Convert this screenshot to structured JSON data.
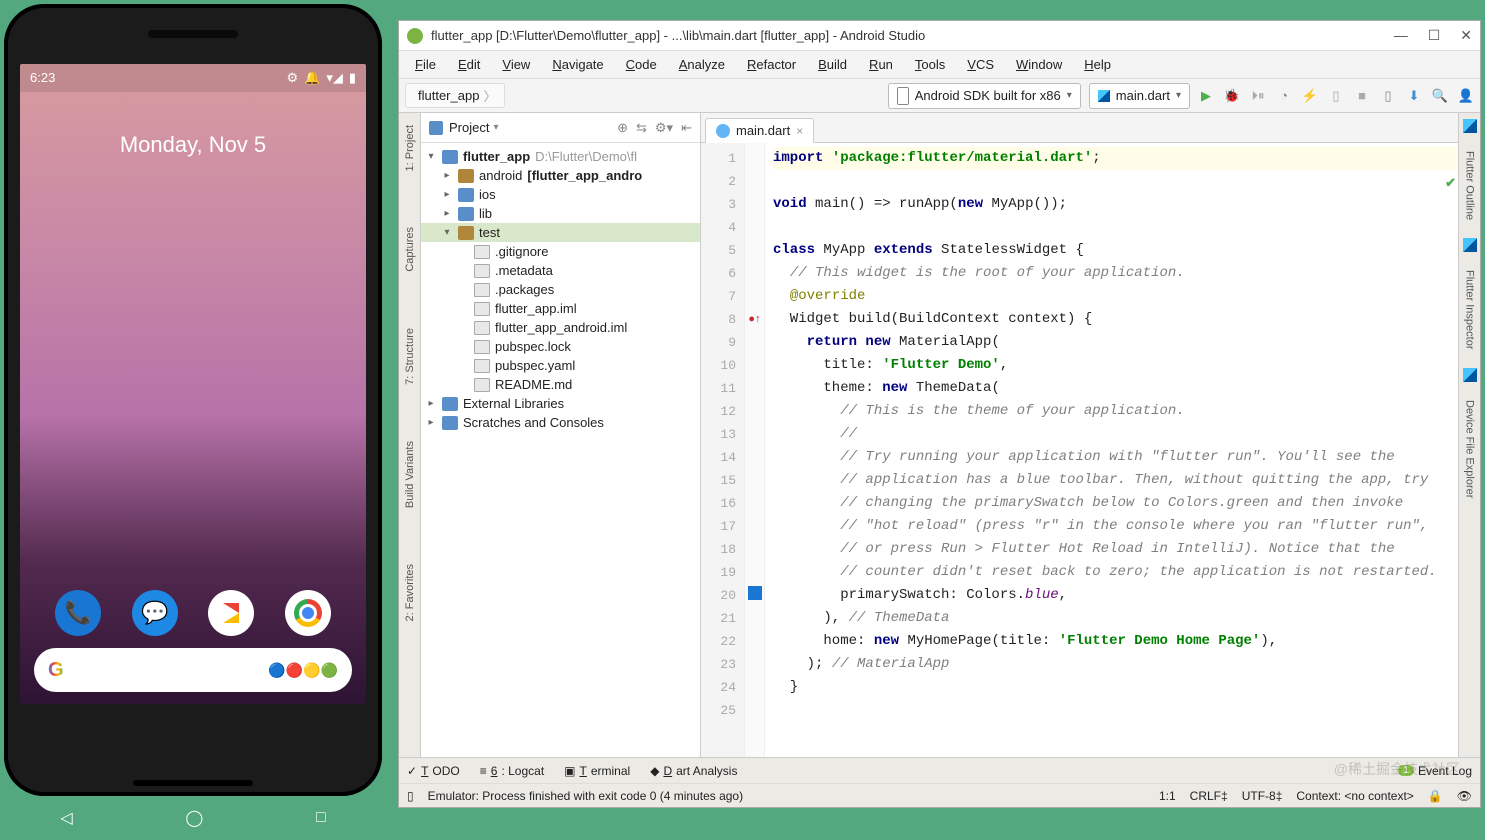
{
  "phone": {
    "time": "6:23",
    "date": "Monday, Nov 5",
    "nav": {
      "back": "◁",
      "home": "◯",
      "recent": "□"
    }
  },
  "ide": {
    "title": "flutter_app [D:\\Flutter\\Demo\\flutter_app] - ...\\lib\\main.dart [flutter_app] - Android Studio",
    "menus": [
      "File",
      "Edit",
      "View",
      "Navigate",
      "Code",
      "Analyze",
      "Refactor",
      "Build",
      "Run",
      "Tools",
      "VCS",
      "Window",
      "Help"
    ],
    "breadcrumb": "flutter_app",
    "device_combo": "Android SDK built for x86",
    "config_combo": "main.dart",
    "left_tabs": [
      "1: Project",
      "Captures",
      "7: Structure",
      "Build Variants",
      "2: Favorites"
    ],
    "right_tabs": [
      "Flutter Outline",
      "Flutter Inspector",
      "Device File Explorer"
    ],
    "project_panel": {
      "title": "Project",
      "root": {
        "name": "flutter_app",
        "path": "D:\\Flutter\\Demo\\fl"
      },
      "items": [
        {
          "type": "folder",
          "name": "android",
          "suffix": "[flutter_app_andro",
          "indent": 1,
          "arrow": "▸"
        },
        {
          "type": "folder-blue",
          "name": "ios",
          "indent": 1,
          "arrow": "▸"
        },
        {
          "type": "folder-blue",
          "name": "lib",
          "indent": 1,
          "arrow": "▸"
        },
        {
          "type": "folder",
          "name": "test",
          "indent": 1,
          "arrow": "▾",
          "sel": true,
          "blue": false
        },
        {
          "type": "file",
          "name": ".gitignore",
          "indent": 2
        },
        {
          "type": "file",
          "name": ".metadata",
          "indent": 2
        },
        {
          "type": "file",
          "name": ".packages",
          "indent": 2
        },
        {
          "type": "file",
          "name": "flutter_app.iml",
          "indent": 2
        },
        {
          "type": "file",
          "name": "flutter_app_android.iml",
          "indent": 2
        },
        {
          "type": "file",
          "name": "pubspec.lock",
          "indent": 2
        },
        {
          "type": "file",
          "name": "pubspec.yaml",
          "indent": 2
        },
        {
          "type": "file",
          "name": "README.md",
          "indent": 2
        }
      ],
      "ext_lib": "External Libraries",
      "scratches": "Scratches and Consoles"
    },
    "tab_name": "main.dart",
    "code_lines": [
      {
        "n": 1,
        "html": "<span class='kw'>import</span> <span class='str'>'package:flutter/material.dart'</span>;",
        "hl": true
      },
      {
        "n": 2,
        "html": ""
      },
      {
        "n": 3,
        "html": "<span class='kw'>void</span> main() =&gt; runApp(<span class='kw'>new</span> MyApp());"
      },
      {
        "n": 4,
        "html": ""
      },
      {
        "n": 5,
        "html": "<span class='kw'>class</span> MyApp <span class='kw'>extends</span> StatelessWidget {"
      },
      {
        "n": 6,
        "html": "  <span class='cm'>// This widget is the root of your application.</span>"
      },
      {
        "n": 7,
        "html": "  <span class='an'>@override</span>"
      },
      {
        "n": 8,
        "html": "  Widget build(BuildContext context) {",
        "marker": "●↑"
      },
      {
        "n": 9,
        "html": "    <span class='kw'>return new</span> MaterialApp("
      },
      {
        "n": 10,
        "html": "      title: <span class='str'>'Flutter Demo'</span>,"
      },
      {
        "n": 11,
        "html": "      theme: <span class='kw'>new</span> ThemeData("
      },
      {
        "n": 12,
        "html": "        <span class='cm'>// This is the theme of your application.</span>"
      },
      {
        "n": 13,
        "html": "        <span class='cm'>//</span>"
      },
      {
        "n": 14,
        "html": "        <span class='cm'>// Try running your application with \"flutter run\". You'll see the</span>"
      },
      {
        "n": 15,
        "html": "        <span class='cm'>// application has a blue toolbar. Then, without quitting the app, try</span>"
      },
      {
        "n": 16,
        "html": "        <span class='cm'>// changing the primarySwatch below to Colors.green and then invoke</span>"
      },
      {
        "n": 17,
        "html": "        <span class='cm'>// \"hot reload\" (press \"r\" in the console where you ran \"flutter run\",</span>"
      },
      {
        "n": 18,
        "html": "        <span class='cm'>// or press Run &gt; Flutter Hot Reload in IntelliJ). Notice that the</span>"
      },
      {
        "n": 19,
        "html": "        <span class='cm'>// counter didn't reset back to zero; the application is not restarted.</span>"
      },
      {
        "n": 20,
        "html": "        primarySwatch: Colors.<span class='id'>blue</span>,",
        "swatch": true
      },
      {
        "n": 21,
        "html": "      ), <span class='cm'>// ThemeData</span>"
      },
      {
        "n": 22,
        "html": "      home: <span class='kw'>new</span> MyHomePage(title: <span class='str'>'Flutter Demo Home Page'</span>),"
      },
      {
        "n": 23,
        "html": "    ); <span class='cm'>// MaterialApp</span>"
      },
      {
        "n": 24,
        "html": "  }"
      },
      {
        "n": 25,
        "html": ""
      }
    ],
    "bottom_tabs": [
      "TODO",
      "6: Logcat",
      "Terminal",
      "Dart Analysis"
    ],
    "event_log": "Event Log",
    "status_msg": "Emulator: Process finished with exit code 0 (4 minutes ago)",
    "status_right": {
      "pos": "1:1",
      "le": "CRLF",
      "enc": "UTF-8",
      "ctx": "Context: <no context>"
    },
    "watermark": "@稀土掘金技术社区"
  }
}
